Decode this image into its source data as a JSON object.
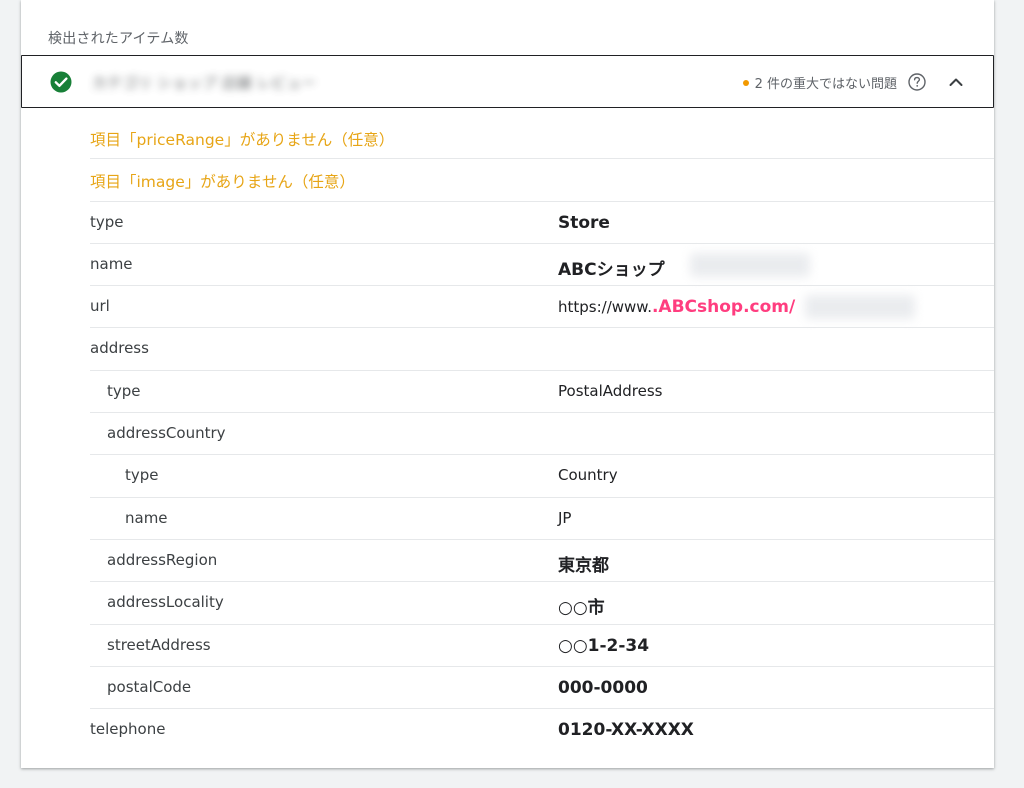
{
  "section": {
    "title": "検出されたアイテム数"
  },
  "item": {
    "name": "カテゴリ ショップ 店舗 レビュー",
    "issues_label": "2 件の重大ではない問題",
    "colors": {
      "ok": "#188038",
      "warning": "#f29900",
      "highlight": "#ff3d7f"
    },
    "icons": {
      "status": "check-circle-icon",
      "help": "help-circle-icon",
      "collapse": "chevron-up-icon"
    }
  },
  "warnings": [
    "項目「priceRange」がありません（任意）",
    "項目「image」がありません（任意）"
  ],
  "properties": [
    {
      "key": "type",
      "value": "Store"
    },
    {
      "key": "name",
      "value": "ABCショップ"
    },
    {
      "key": "url",
      "value_prefix": "https://www.",
      "value": ".ABCshop.com/"
    },
    {
      "key": "address",
      "value": ""
    },
    {
      "key": "type",
      "value": "PostalAddress"
    },
    {
      "key": "addressCountry",
      "value": ""
    },
    {
      "key": "type",
      "value": "Country"
    },
    {
      "key": "name",
      "value": "JP"
    },
    {
      "key": "addressRegion",
      "value": "東京都"
    },
    {
      "key": "addressLocality",
      "value": "○○市"
    },
    {
      "key": "streetAddress",
      "value": "○○1-2-34"
    },
    {
      "key": "postalCode",
      "value": "000-0000"
    },
    {
      "key": "telephone",
      "value": "0120-XX-XXXX"
    }
  ]
}
